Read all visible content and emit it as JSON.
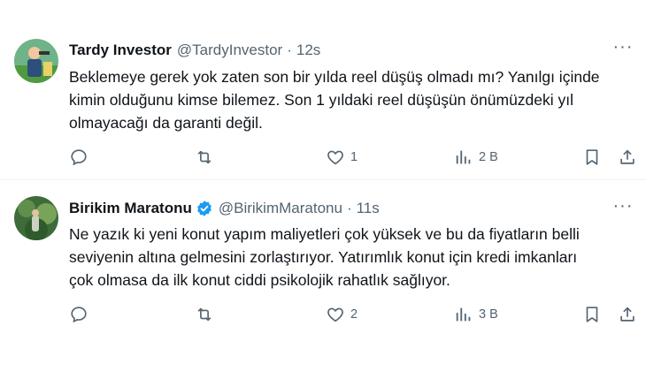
{
  "tweets": [
    {
      "name": "Tardy Investor",
      "handle": "@TardyInvestor",
      "dot": "·",
      "time": "12s",
      "text": "Beklemeye gerek yok zaten son bir yılda reel düşüş olmadı mı? Yanılgı içinde\nkimin olduğunu kimse bilemez. Son 1 yıldaki reel düşüşün önümüzdeki yıl\nolmayacağı da garanti değil.",
      "verified": false,
      "likes": "1",
      "views": "2 B",
      "more": "···"
    },
    {
      "name": "Birikim Maratonu",
      "handle": "@BirikimMaratonu",
      "dot": "·",
      "time": "11s",
      "text": "Ne yazık ki yeni konut yapım maliyetleri çok yüksek ve bu da fiyatların belli\nseviyenin altına gelmesini zorlaştırıyor. Yatırımlık konut için kredi imkanları\nçok olmasa da ilk konut ciddi psikolojik rahatlık sağlıyor.",
      "verified": true,
      "likes": "2",
      "views": "3 B",
      "more": "···"
    }
  ],
  "icons": {
    "reply": "reply-icon",
    "retweet": "retweet-icon",
    "like": "heart-icon",
    "views": "views-icon",
    "bookmark": "bookmark-icon",
    "share": "share-icon",
    "verified": "verified-badge-icon"
  },
  "colors": {
    "text": "#0f1419",
    "secondary": "#536471",
    "verified": "#1d9bf0",
    "divider": "#eff3f4"
  }
}
